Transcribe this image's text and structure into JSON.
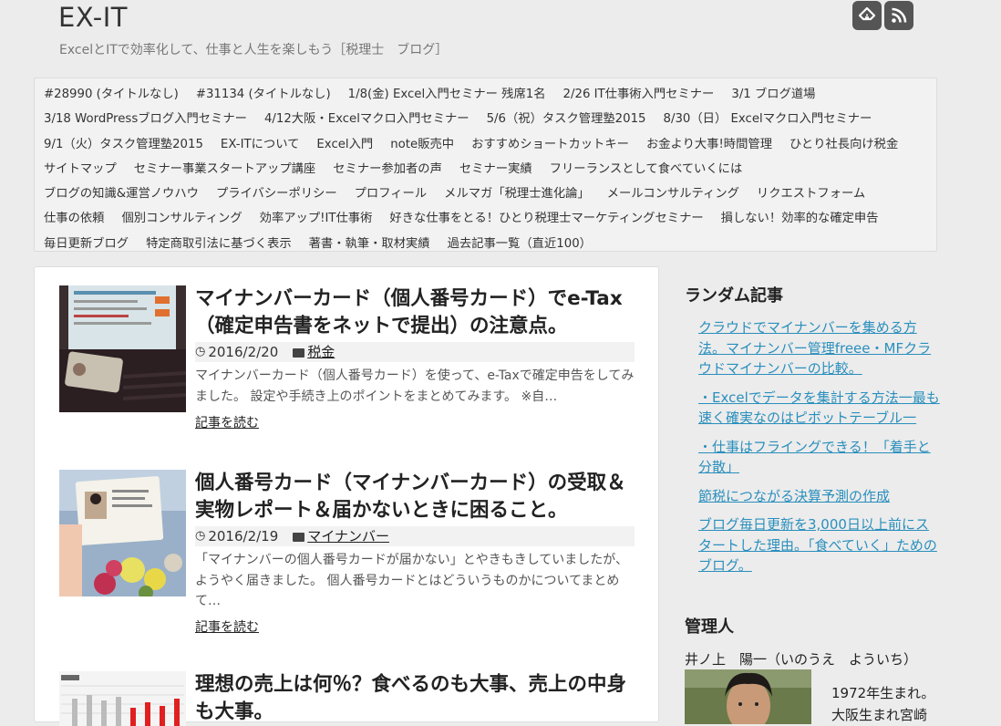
{
  "site": {
    "title": "EX-IT",
    "tagline": "ExcelとITで効率化して、仕事と人生を楽しもう［税理士　ブログ］"
  },
  "social": [
    {
      "icon": "feedly-icon"
    },
    {
      "icon": "rss-icon"
    }
  ],
  "nav": [
    "#28990 (タイトルなし)",
    "#31134 (タイトルなし)",
    "1/8(金) Excel入門セミナー 残席1名",
    "2/26 IT仕事術入門セミナー",
    "3/1 ブログ道場",
    "3/18 WordPressブログ入門セミナー",
    "4/12大阪・Excelマクロ入門セミナー",
    "5/6（祝）タスク管理塾2015",
    "8/30（日） Excelマクロ入門セミナー",
    "9/1（火）タスク管理塾2015",
    "EX-ITについて",
    "Excel入門",
    "note販売中",
    "おすすめショートカットキー",
    "お金より大事!時間管理",
    "ひとり社長向け税金",
    "サイトマップ",
    "セミナー事業スタートアップ講座",
    "セミナー参加者の声",
    "セミナー実績",
    "フリーランスとして食べていくには",
    "ブログの知識&運営ノウハウ",
    "プライバシーポリシー",
    "プロフィール",
    "メルマガ「税理士進化論」",
    "メールコンサルティング",
    "リクエストフォーム",
    "仕事の依頼",
    "個別コンサルティング",
    "効率アップ!IT仕事術",
    "好きな仕事をとる！ひとり税理士マーケティングセミナー",
    "損しない！効率的な確定申告",
    "毎日更新ブログ",
    "特定商取引法に基づく表示",
    "著書・執筆・取材実績",
    "過去記事一覧（直近100）"
  ],
  "posts": [
    {
      "title": "マイナンバーカード（個人番号カード）でe-Tax（確定申告書をネットで提出）の注意点。",
      "date": "2016/2/20",
      "category": "税金",
      "excerpt": "マイナンバーカード（個人番号カード）を使って、e-Taxで確定申告をしてみました。 設定や手続き上のポイントをまとめてみます。 ※自…",
      "more": "記事を読む"
    },
    {
      "title": "個人番号カード（マイナンバーカード）の受取＆実物レポート＆届かないときに困ること。",
      "date": "2016/2/19",
      "category": "マイナンバー",
      "excerpt": "「マイナンバーの個人番号カードが届かない」とやきもきしていましたが、ようやく届きました。 個人番号カードとはどういうものかについてまとめて…",
      "more": "記事を読む"
    },
    {
      "title": "理想の売上は何％？食べるのも大事、売上の中身も大事。"
    }
  ],
  "sidebar": {
    "random_heading": "ランダム記事",
    "random_links": [
      "クラウドでマイナンバーを集める方法。マイナンバー管理freee・MFクラウドマイナンバーの比較。",
      "・Excelでデータを集計する方法一最も速く確実なのはピボットテーブル一",
      "・仕事はフライングできる！「着手と分散」",
      "節税につながる決算予測の作成",
      "ブログ毎日更新を3,000日以上前にスタートした理由。「食べていく」ためのブログ。"
    ],
    "admin_heading": "管理人",
    "admin_name": "井ノ上　陽一（いのうえ　よういち）",
    "admin_bio_1": "1972年生まれ。",
    "admin_bio_2": "大阪生まれ宮崎"
  }
}
